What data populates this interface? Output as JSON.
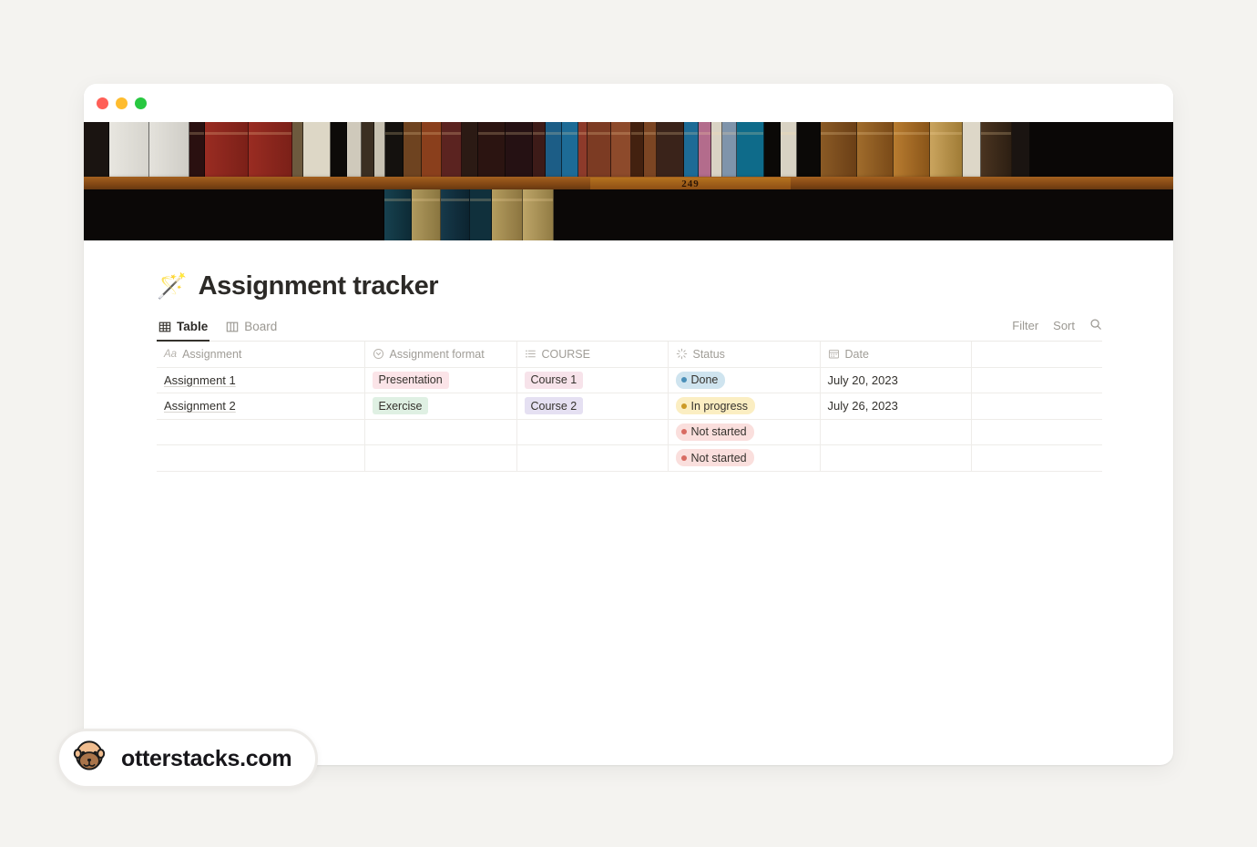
{
  "window": {
    "traffic_lights": [
      {
        "name": "close",
        "color": "#ff5f57"
      },
      {
        "name": "minimize",
        "color": "#febc2e"
      },
      {
        "name": "maximize",
        "color": "#28c840"
      }
    ]
  },
  "cover": {
    "alt": "bookshelf-photo",
    "shelf_label": "249"
  },
  "page": {
    "icon": "magic-wand-emoji",
    "icon_glyph": "🪄",
    "title": "Assignment tracker"
  },
  "tabs": [
    {
      "label": "Table",
      "icon": "table-icon",
      "active": true
    },
    {
      "label": "Board",
      "icon": "board-icon",
      "active": false
    }
  ],
  "view_actions": {
    "filter_label": "Filter",
    "sort_label": "Sort",
    "search_icon": "search-icon"
  },
  "table": {
    "columns": [
      {
        "label": "Assignment",
        "icon": "title-text-icon"
      },
      {
        "label": "Assignment format",
        "icon": "select-icon"
      },
      {
        "label": "COURSE",
        "icon": "multi-select-icon"
      },
      {
        "label": "Status",
        "icon": "status-icon"
      },
      {
        "label": "Date",
        "icon": "calendar-icon"
      },
      {
        "label": "",
        "icon": ""
      }
    ],
    "rows": [
      {
        "assignment": "Assignment 1",
        "format": "Presentation",
        "format_bg": "#fbe4e8",
        "course": "Course 1",
        "course_bg": "#f7e3ea",
        "status": "Done",
        "status_bg": "#cfe4ef",
        "status_dot": "#4a8fb8",
        "date": "July 20, 2023"
      },
      {
        "assignment": "Assignment 2",
        "format": "Exercise",
        "format_bg": "#dff0e3",
        "course": "Course 2",
        "course_bg": "#e5e0f2",
        "status": "In progress",
        "status_bg": "#fbeec2",
        "status_dot": "#cc9a26",
        "date": "July 26, 2023"
      },
      {
        "assignment": "",
        "format": "",
        "format_bg": "transparent",
        "course": "",
        "course_bg": "transparent",
        "status": "Not started",
        "status_bg": "#fadfdd",
        "status_dot": "#d86b62",
        "date": ""
      },
      {
        "assignment": "",
        "format": "",
        "format_bg": "transparent",
        "course": "",
        "course_bg": "transparent",
        "status": "Not started",
        "status_bg": "#fadfdd",
        "status_dot": "#d86b62",
        "date": ""
      }
    ]
  },
  "watermark": {
    "icon": "otter-logo-icon",
    "text": "otterstacks.com"
  }
}
